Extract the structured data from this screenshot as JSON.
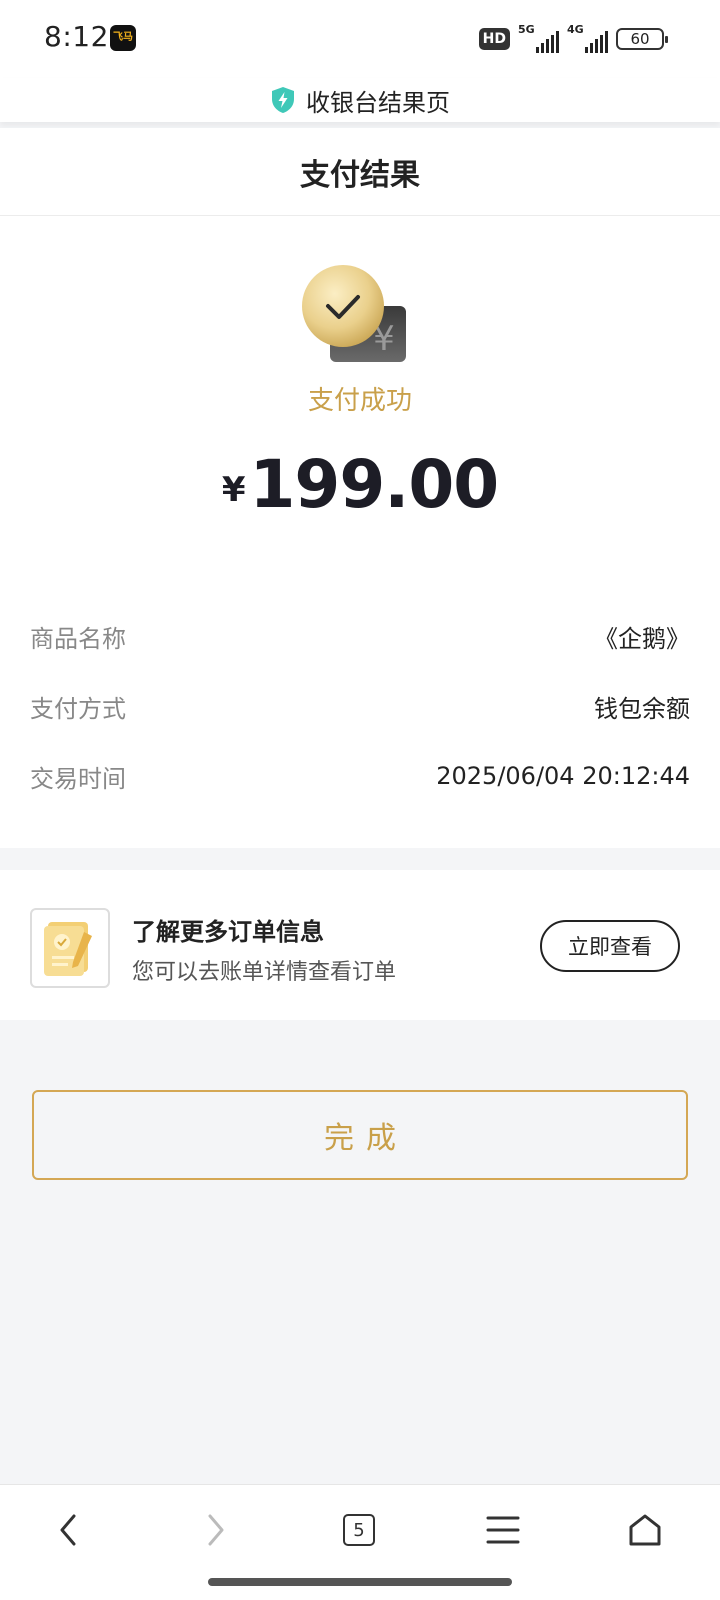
{
  "status_bar": {
    "time": "8:12",
    "app_badge_text": "飞马",
    "hd_label": "HD",
    "net1": "5G",
    "net2": "4G",
    "battery": "60"
  },
  "title_bar": {
    "title": "收银台结果页",
    "icon": "shield-lightning-icon"
  },
  "result": {
    "header": "支付结果",
    "status_text": "支付成功",
    "currency_symbol": "¥",
    "amount": "199.00",
    "rows": [
      {
        "label": "商品名称",
        "value": "《企鹅》"
      },
      {
        "label": "支付方式",
        "value": "钱包余额"
      },
      {
        "label": "交易时间",
        "value": "2025/06/04 20:12:44"
      }
    ]
  },
  "order_info": {
    "title": "了解更多订单信息",
    "subtitle": "您可以去账单详情查看订单",
    "button_label": "立即查看"
  },
  "done_button": "完成",
  "bottom_nav": {
    "tab_count": "5",
    "items": [
      "back-icon",
      "forward-icon",
      "tabs-icon",
      "menu-icon",
      "home-icon"
    ]
  },
  "colors": {
    "accent_gold": "#c9a04a",
    "shield_teal": "#3fc8b8",
    "background": "#f4f5f7"
  }
}
